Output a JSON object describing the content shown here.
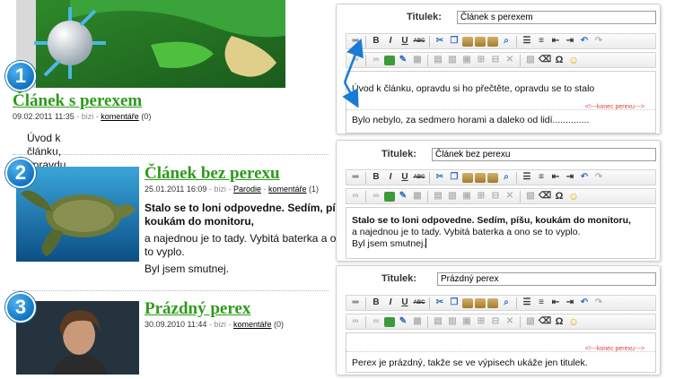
{
  "articles": [
    {
      "number": "1",
      "title": "Článek s perexem",
      "date": "09.02.2011 11:35",
      "author": "bizi",
      "category": "",
      "comments_label": "komentáře",
      "comments_count": "(0)",
      "perex": [
        "Úvod k článku, opravdu si ho přečtěte, opravdu se to stalo"
      ]
    },
    {
      "number": "2",
      "title": "Článek bez perexu",
      "date": "25.01.2011 16:09",
      "author": "bizi",
      "category": "Parodie",
      "comments_label": "komentáře",
      "comments_count": "(1)",
      "perex_bold": [
        "Stalo se to loni odpovedne. Sedím, píšu,",
        "koukám do monitoru,"
      ],
      "perex": [
        "a najednou je to tady. Vybitá baterka a ono se",
        "to vyplo.",
        "Byl jsem smutnej."
      ]
    },
    {
      "number": "3",
      "title": "Prázdný perex",
      "date": "30.09.2010 11:44",
      "author": "bizi",
      "category": "",
      "comments_label": "komentáře",
      "comments_count": "(0)",
      "perex": []
    }
  ],
  "editors": [
    {
      "title_label": "Titulek:",
      "title_value": "Článek s perexem",
      "body": [
        "Úvod k článku, opravdu si ho přečtěte, opravdu se to stalo"
      ],
      "end_marker": "<!---konec perexu--->",
      "after": [
        "Bylo nebylo, za sedmero horami a daleko od lidí.............."
      ]
    },
    {
      "title_label": "Titulek:",
      "title_value": "Článek bez perexu",
      "body_bold": "Stalo se to loni odpovedne. Sedím, píšu, koukám do monitoru,",
      "body": [
        "a najednou je to tady. Vybitá baterka a ono se to vyplo.",
        "Byl jsem smutnej."
      ]
    },
    {
      "title_label": "Titulek:",
      "title_value": "Prázdný perex",
      "end_marker": "<!---konec perexu--->",
      "after": [
        "Perex je prázdný, takže se ve výpisech ukáže jen titulek."
      ]
    }
  ],
  "toolbar": {
    "row1": [
      "hr-icon",
      "bold-icon",
      "italic-icon",
      "underline-icon",
      "strike-icon",
      "cut-icon",
      "copy-icon",
      "paste-icon",
      "paste-text-icon",
      "paste-word-icon",
      "find-icon",
      "unordered-list-icon",
      "ordered-list-icon",
      "outdent-icon",
      "indent-icon",
      "undo-icon",
      "redo-icon"
    ],
    "row2": [
      "link-icon",
      "unlink-icon",
      "image-icon",
      "edit-icon",
      "table-icon",
      "row-icon",
      "col-icon",
      "cell-icon",
      "merge-icon",
      "split-icon",
      "delete-icon",
      "media-icon",
      "clean-icon",
      "omega-icon",
      "smiley-icon"
    ],
    "labels": {
      "bold": "B",
      "italic": "I",
      "underline": "U",
      "strike": "ABC",
      "omega": "Ω"
    }
  },
  "colors": {
    "title_green": "#2d9b1b",
    "badge_blue": "#1275c4",
    "marker_red": "#e23d3d",
    "arrow_blue": "#1a7bd6"
  }
}
